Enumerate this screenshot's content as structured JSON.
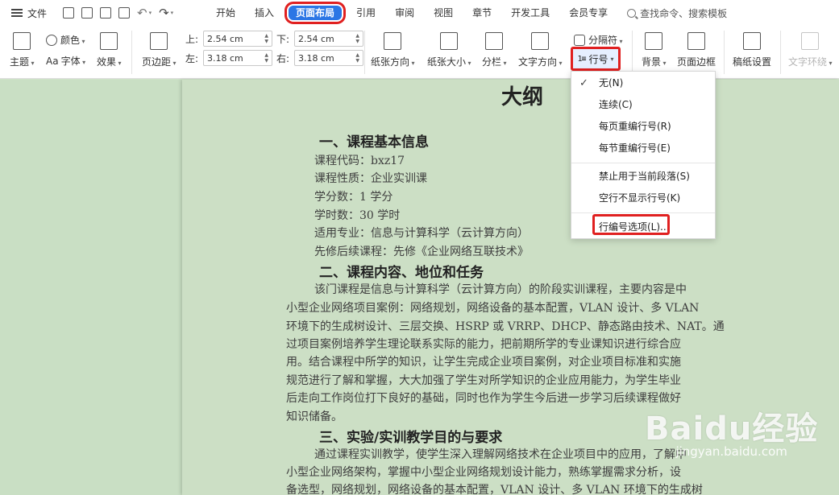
{
  "menubar": {
    "file_label": "文件",
    "tabs": [
      "开始",
      "插入",
      "页面布局",
      "引用",
      "审阅",
      "视图",
      "章节",
      "开发工具",
      "会员专享"
    ],
    "active_tab": "页面布局",
    "search_placeholder": "查找命令、搜索模板"
  },
  "ribbon": {
    "theme": "主题",
    "colors": "颜色",
    "fonts": "字体",
    "font_prefix": "Aa",
    "effects": "效果",
    "margins": "页边距",
    "margin_top_label": "上:",
    "margin_top_value": "2.54 cm",
    "margin_bottom_label": "下:",
    "margin_bottom_value": "2.54 cm",
    "margin_left_label": "左:",
    "margin_left_value": "3.18 cm",
    "margin_right_label": "右:",
    "margin_right_value": "3.18 cm",
    "orientation": "纸张方向",
    "size": "纸张大小",
    "columns": "分栏",
    "text_direction": "文字方向",
    "breaks": "分隔符",
    "line_numbers": "行号",
    "background": "背景",
    "page_border": "页面边框",
    "grid_paper": "稿纸设置",
    "text_wrap": "文字环绕"
  },
  "dropdown": {
    "items": [
      "无(N)",
      "连续(C)",
      "每页重编行号(R)",
      "每节重编行号(E)",
      "禁止用于当前段落(S)",
      "空行不显示行号(K)",
      "行编号选项(L)..."
    ],
    "checked_index": 0
  },
  "document": {
    "title": "大纲",
    "section1_heading": "一、课程基本信息",
    "info_lines": [
      "课程代码：bxz17",
      "课程性质：企业实训课",
      "学分数：1 学分",
      "学时数：30 学时",
      "适用专业：信息与计算科学（云计算方向）",
      "先修后续课程：先修《企业网络互联技术》"
    ],
    "section2_heading": "二、课程内容、地位和任务",
    "section2_lines": [
      "该门课程是信息与计算科学（云计算方向）的阶段实训课程，主要内容是中",
      "小型企业网络项目案例：网络规划，网络设备的基本配置，VLAN 设计、多 VLAN",
      "环境下的生成树设计、三层交换、HSRP 或 VRRP、DHCP、静态路由技术、NAT。通",
      "过项目案例培养学生理论联系实际的能力，把前期所学的专业课知识进行综合应",
      "用。结合课程中所学的知识，让学生完成企业项目案例，对企业项目标准和实施",
      "规范进行了解和掌握，大大加强了学生对所学知识的企业应用能力，为学生毕业",
      "后走向工作岗位打下良好的基础，同时也作为学生今后进一步学习后续课程做好",
      "知识储备。"
    ],
    "section3_heading": "三、实验/实训教学目的与要求",
    "section3_lines": [
      "通过课程实训教学，使学生深入理解网络技术在企业项目中的应用，了解中",
      "小型企业网络架构，掌握中小型企业网络规划设计能力，熟练掌握需求分析，设",
      "备选型，网络规划，网络设备的基本配置，VLAN 设计、多 VLAN 环境下的生成树"
    ]
  },
  "watermark": {
    "logo": "Baidu经验",
    "sub": "jingyan.baidu.com"
  }
}
